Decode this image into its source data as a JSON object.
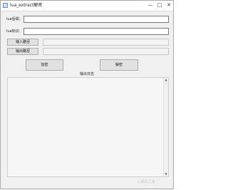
{
  "window": {
    "title": "lua_extract解密",
    "minimize_glyph": "—",
    "maximize_glyph": "□",
    "close_glyph": "✕"
  },
  "form": {
    "suffix_label": "lua后缀：",
    "suffix_value": "",
    "signature_label": "lua标识：",
    "signature_value": "",
    "input_path_button": "输入路径",
    "input_path_value": "",
    "output_path_button": "输出路径",
    "output_path_value": ""
  },
  "actions": {
    "encrypt_button": "加密",
    "decrypt_button": "解密"
  },
  "log": {
    "title": "输出日志",
    "scroll_up_glyph": "▲",
    "scroll_down_glyph": "▼"
  },
  "watermark": {
    "text": "ɤ 脚本之家"
  }
}
